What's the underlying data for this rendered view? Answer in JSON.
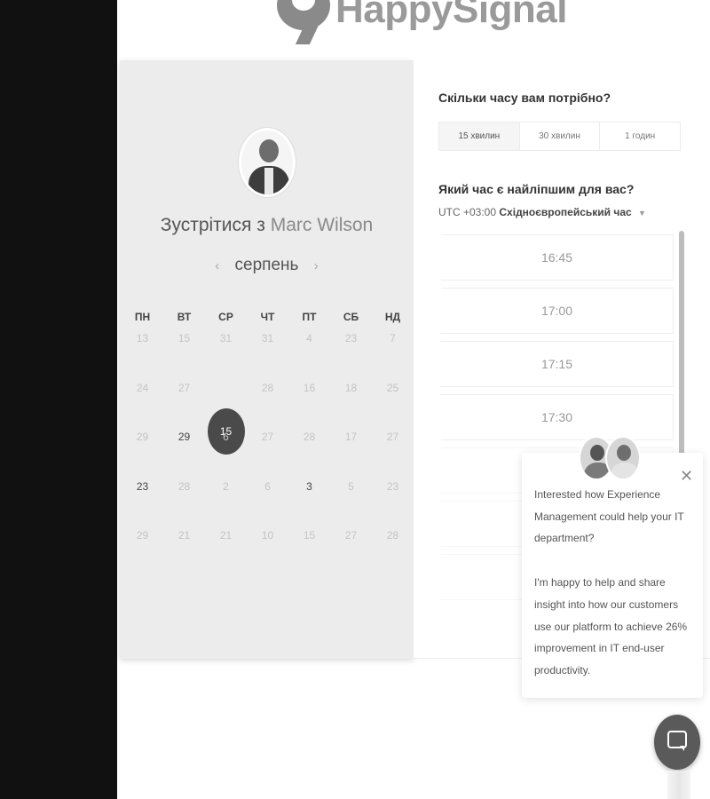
{
  "brand": {
    "name": "HappySignals",
    "accent_color": "#8a8a8a"
  },
  "calendar": {
    "title_prefix": "Зустрітися з",
    "host_name": "Marc Wilson",
    "month": "серпень",
    "prev_icon": "‹",
    "next_icon": "›",
    "weekdays": [
      "ПН",
      "ВТ",
      "СР",
      "ЧТ",
      "ПТ",
      "СБ",
      "НД"
    ],
    "days": [
      [
        "13",
        "15",
        "31",
        "31",
        "4",
        "23",
        "7"
      ],
      [
        "24",
        "27",
        "15",
        "28",
        "16",
        "18",
        "25"
      ],
      [
        "29",
        "29",
        "6",
        "27",
        "28",
        "17",
        "27"
      ],
      [
        "23",
        "28",
        "2",
        "6",
        "3",
        "5",
        "23"
      ],
      [
        "29",
        "21",
        "21",
        "10",
        "15",
        "27",
        "28"
      ]
    ],
    "selected_day": "15",
    "available_days": [
      "29",
      "23",
      "3"
    ]
  },
  "duration": {
    "question": "Скільки часу вам потрібно?",
    "options": [
      "15 хвилин",
      "30 хвилин",
      "1 годин"
    ],
    "selected": "15 хвилин"
  },
  "time_selection": {
    "question": "Який час є найліпшим для вас?",
    "timezone_offset": "UTC +03:00",
    "timezone_name": "Східноєвропейський час",
    "slots": [
      "16:45",
      "17:00",
      "17:15",
      "17:30"
    ]
  },
  "chat_popup": {
    "message_1": "Interested how Experience Management could help your IT department?",
    "message_2": "I'm happy to help and share insight into how our customers use our platform to achieve 26% improvement in IT end-user productivity.",
    "close_icon": "close-icon",
    "chat_icon": "chat-bubble-icon"
  }
}
